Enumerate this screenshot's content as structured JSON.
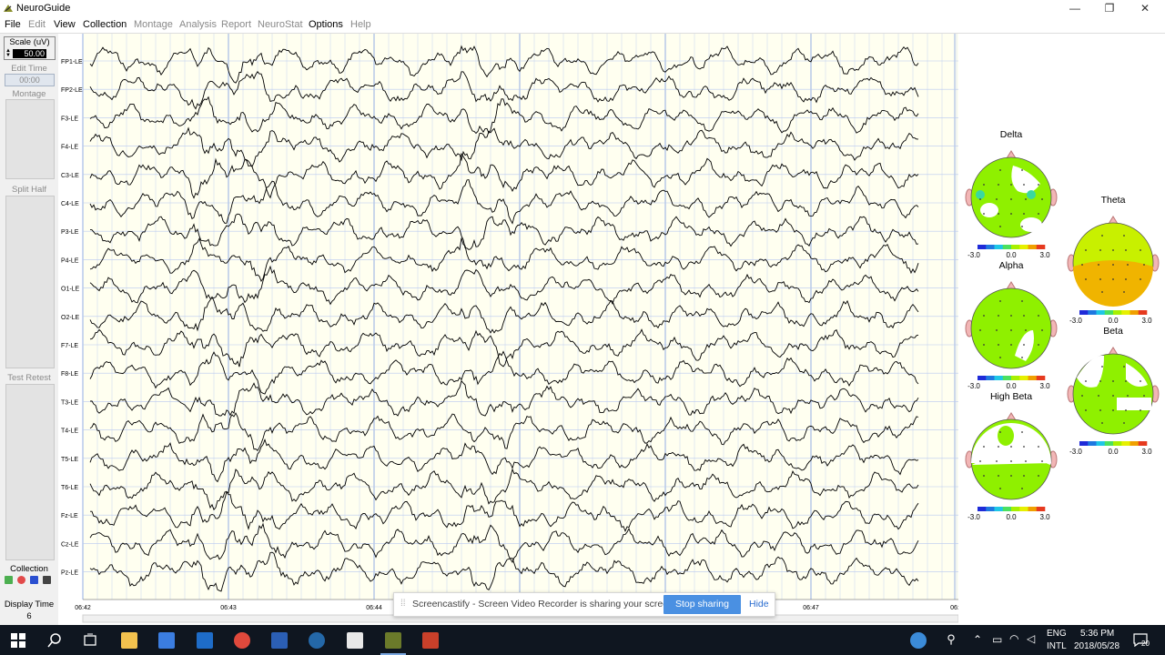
{
  "window": {
    "title": "NeuroGuide",
    "minimize": "—",
    "restore": "❐",
    "close": "✕"
  },
  "menu": [
    {
      "label": "File",
      "enabled": true
    },
    {
      "label": "Edit",
      "enabled": false
    },
    {
      "label": "View",
      "enabled": true
    },
    {
      "label": "Collection",
      "enabled": true
    },
    {
      "label": "Montage",
      "enabled": false
    },
    {
      "label": "Analysis",
      "enabled": false
    },
    {
      "label": "Report",
      "enabled": false
    },
    {
      "label": "NeuroStat",
      "enabled": false
    },
    {
      "label": "Options",
      "enabled": true
    },
    {
      "label": "Help",
      "enabled": false
    }
  ],
  "left_panel": {
    "scale_label": "Scale (uV)",
    "scale_value": "50.00",
    "edit_time_label": "Edit Time",
    "edit_time_value": "00:00",
    "montage_label": "Montage",
    "split_half_label": "Split Half",
    "test_retest_label": "Test Retest",
    "collection_label": "Collection",
    "display_time_label": "Display Time",
    "display_time_value": "6"
  },
  "eeg": {
    "channels": [
      "FP1-LE",
      "FP2-LE",
      "F3-LE",
      "F4-LE",
      "C3-LE",
      "C4-LE",
      "P3-LE",
      "P4-LE",
      "O1-LE",
      "O2-LE",
      "F7-LE",
      "F8-LE",
      "T3-LE",
      "T4-LE",
      "T5-LE",
      "T6-LE",
      "Fz-LE",
      "Cz-LE",
      "Pz-LE"
    ],
    "time_labels": [
      "06:42",
      "06:43",
      "06:44",
      "06:45",
      "06:46",
      "06:47",
      "06:"
    ],
    "colors": {
      "background": "#fffff0",
      "grid_minor": "#b8c8f0",
      "grid_major": "#7f9fe0",
      "trace": "#000000"
    }
  },
  "topomaps": [
    {
      "title": "Delta",
      "scale": [
        "-3.0",
        "0.0",
        "3.0"
      ],
      "fill": "#8ff000"
    },
    {
      "title": "Theta",
      "scale": [
        "-3.0",
        "0.0",
        "3.0"
      ],
      "fill": "#c8f000"
    },
    {
      "title": "Alpha",
      "scale": [
        "-3.0",
        "0.0",
        "3.0"
      ],
      "fill": "#8ff000"
    },
    {
      "title": "Beta",
      "scale": [
        "-3.0",
        "0.0",
        "3.0"
      ],
      "fill": "#8ff000"
    },
    {
      "title": "High Beta",
      "scale": [
        "-3.0",
        "0.0",
        "3.0"
      ],
      "fill": "#8ff000"
    }
  ],
  "toast": {
    "message": "Screencastify - Screen Video Recorder is sharing your screen.",
    "stop_label": "Stop sharing",
    "hide_label": "Hide"
  },
  "taskbar": {
    "lang_top": "ENG",
    "lang_bottom": "INTL",
    "time": "5:36 PM",
    "date": "2018/05/28",
    "notification_count": "20"
  }
}
